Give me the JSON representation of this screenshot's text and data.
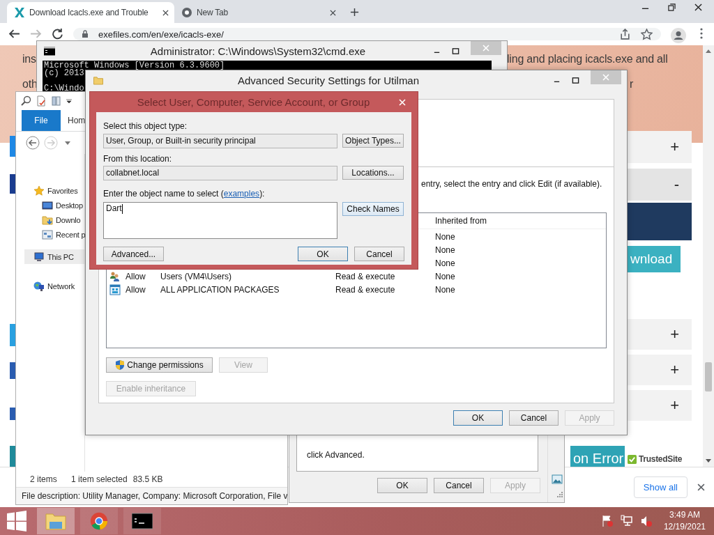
{
  "browser": {
    "tabs": [
      {
        "title": "Download Icacls.exe and Trouble",
        "selected": true
      },
      {
        "title": "New Tab",
        "selected": false
      }
    ],
    "url": "exefiles.com/en/exe/icacls-exe/",
    "banner": {
      "left_lines": [
        "ins",
        "oth"
      ],
      "right_lines": [
        "ling and placing icacls.exe and all",
        "r"
      ]
    },
    "accordion_top": [
      {
        "symbol": "+",
        "expanded": false
      },
      {
        "symbol": "-",
        "expanded": true
      }
    ],
    "download_button": "wnload",
    "accordion_bottom": [
      {
        "symbol": "+",
        "expanded": false
      },
      {
        "symbol": "+",
        "expanded": false
      },
      {
        "symbol": "+",
        "expanded": false
      }
    ],
    "footer_banner": "on Error",
    "badge": "TrustedSite",
    "show_all": "Show all"
  },
  "cmd": {
    "title": "Administrator: C:\\Windows\\System32\\cmd.exe",
    "lines": [
      "Microsoft Windows [Version 6.3.9600]",
      "(c) 2013"
    ],
    "prompt": "C:\\Windo"
  },
  "explorer": {
    "ribbon_tabs": [
      {
        "label": "File",
        "kind": "application"
      },
      {
        "label": "Hom",
        "kind": "tab"
      }
    ],
    "nav": [
      {
        "label": "Favorites",
        "kind": "favorites",
        "selected": false,
        "children": [
          {
            "label": "Desktop",
            "kind": "desktop",
            "selected": false
          },
          {
            "label": "Downlo",
            "kind": "downloads",
            "selected": false
          },
          {
            "label": "Recent p",
            "kind": "recent",
            "selected": false
          }
        ]
      },
      {
        "label": "This PC",
        "kind": "pc",
        "selected": true
      },
      {
        "label": "Network",
        "kind": "network",
        "selected": false
      }
    ],
    "item_count": "2 items",
    "selection": "1 item selected",
    "size": "83.5 KB",
    "description": "File description: Utility Manager, Company: Microsoft Corporation, File v"
  },
  "properties": {
    "text": "click Advanced.",
    "buttons": [
      {
        "label": "OK",
        "disabled": false
      },
      {
        "label": "Cancel",
        "disabled": false
      },
      {
        "label": "Apply",
        "disabled": true
      }
    ]
  },
  "advanced": {
    "title": "Advanced Security Settings for Utilman",
    "instruction": "entry, select the entry and click Edit (if available).",
    "column": "Inherited from",
    "rows": [
      {
        "kind": "hidden",
        "inherited": "None"
      },
      {
        "kind": "hidden",
        "inherited": "None"
      },
      {
        "kind": "hidden",
        "inherited": "None"
      },
      {
        "kind": "users",
        "access": "Allow",
        "principal": "Users (VM4\\Users)",
        "permission": "Read & execute",
        "inherited": "None"
      },
      {
        "kind": "packages",
        "access": "Allow",
        "principal": "ALL APPLICATION PACKAGES",
        "permission": "Read & execute",
        "inherited": "None"
      }
    ],
    "action_buttons": [
      {
        "label": "Change permissions",
        "kind": "shield",
        "disabled": false
      },
      {
        "label": "View",
        "kind": "plain",
        "disabled": true
      }
    ],
    "inheritance_button": {
      "label": "Enable inheritance",
      "disabled": true
    },
    "buttons": [
      {
        "label": "OK",
        "disabled": false
      },
      {
        "label": "Cancel",
        "disabled": false
      },
      {
        "label": "Apply",
        "disabled": true
      }
    ]
  },
  "select": {
    "title": "Select User, Computer, Service Account, or Group",
    "type_label": "Select this object type:",
    "type_value": "User, Group, or Built-in security principal",
    "type_button": "Object Types...",
    "location_label": "From this location:",
    "location_value": "collabnet.local",
    "location_button": "Locations...",
    "name_label_before": "Enter the object name to select (",
    "name_link": "examples",
    "name_label_after": "):",
    "name_value": "Dart",
    "check_button": "Check Names",
    "advanced_button": "Advanced...",
    "ok": "OK",
    "cancel": "Cancel"
  },
  "taskbar": {
    "apps": [
      {
        "kind": "explorer",
        "active": true
      },
      {
        "kind": "chrome",
        "active": false
      },
      {
        "kind": "cmd",
        "active": false
      }
    ],
    "time": "3:49 AM",
    "date": "12/19/2021"
  }
}
